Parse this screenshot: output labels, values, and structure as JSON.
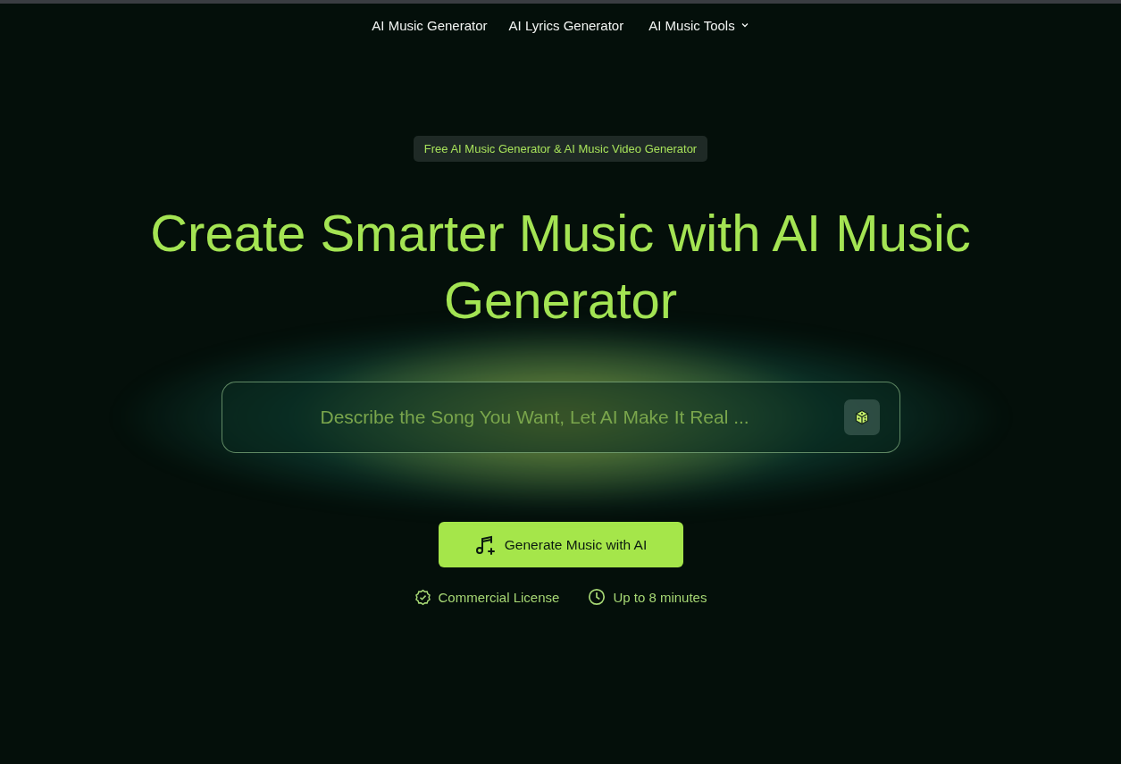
{
  "nav": {
    "items": [
      {
        "label": "AI Music Generator",
        "has_menu": false
      },
      {
        "label": "AI Lyrics Generator",
        "has_menu": false
      },
      {
        "label": "AI Music Tools",
        "has_menu": true
      }
    ]
  },
  "hero": {
    "badge": "Free AI Music Generator & AI Music Video Generator",
    "headline": "Create Smarter Music with AI Music Generator",
    "prompt": {
      "placeholder": "Describe the Song You Want, Let AI Make It Real ..."
    },
    "button": "Generate Music with AI",
    "features": [
      {
        "kind": "license",
        "label": "Commercial License"
      },
      {
        "kind": "clock",
        "label": "Up to 8 minutes"
      }
    ]
  }
}
